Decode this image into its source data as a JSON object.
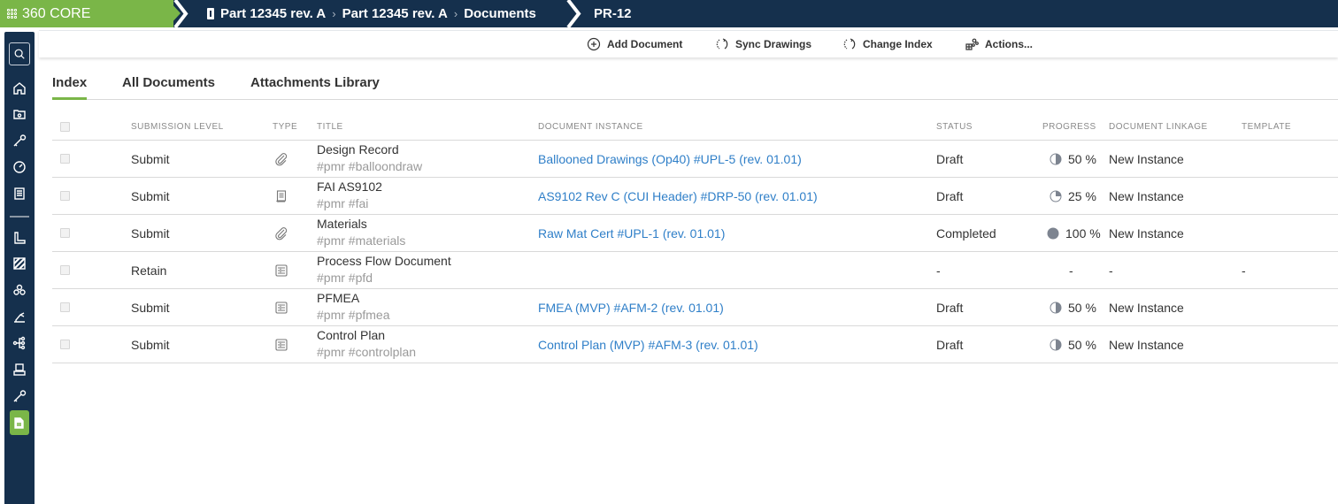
{
  "topbar": {
    "brand": "360 CORE",
    "breadcrumbs": [
      "Part 12345 rev. A",
      "Part 12345 rev. A",
      "Documents"
    ],
    "record": "PR-12"
  },
  "sidebar": {
    "items": [
      "search",
      "home",
      "folder",
      "gauge-tool",
      "dashboard",
      "document-list",
      "ruler",
      "hatch",
      "components",
      "robot-arm",
      "flow-tree",
      "machine",
      "gauge-tool-2",
      "documents-active"
    ]
  },
  "toolbar": {
    "add_document": "Add Document",
    "sync_drawings": "Sync Drawings",
    "change_index": "Change Index",
    "actions": "Actions..."
  },
  "tabs": [
    {
      "label": "Index",
      "active": true
    },
    {
      "label": "All Documents",
      "active": false
    },
    {
      "label": "Attachments Library",
      "active": false
    }
  ],
  "table": {
    "headers": {
      "submission_level": "SUBMISSION LEVEL",
      "type": "TYPE",
      "title": "TITLE",
      "document_instance": "DOCUMENT INSTANCE",
      "status": "STATUS",
      "progress": "PROGRESS",
      "document_linkage": "DOCUMENT LINKAGE",
      "template": "TEMPLATE"
    },
    "rows": [
      {
        "submission": "Submit",
        "type": "attachment",
        "title": "Design Record",
        "tags": "#pmr #balloondraw",
        "instance": "Ballooned Drawings (Op40) #UPL-5 (rev. 01.01)",
        "status": "Draft",
        "progress": 50,
        "progress_label": "50 %",
        "linkage": "New Instance",
        "template": ""
      },
      {
        "submission": "Submit",
        "type": "form",
        "title": "FAI AS9102",
        "tags": "#pmr #fai",
        "instance": "AS9102 Rev C (CUI Header) #DRP-50 (rev. 01.01)",
        "status": "Draft",
        "progress": 25,
        "progress_label": "25 %",
        "linkage": "New Instance",
        "template": ""
      },
      {
        "submission": "Submit",
        "type": "attachment",
        "title": "Materials",
        "tags": "#pmr #materials",
        "instance": "Raw Mat Cert #UPL-1 (rev. 01.01)",
        "status": "Completed",
        "progress": 100,
        "progress_label": "100 %",
        "linkage": "New Instance",
        "template": ""
      },
      {
        "submission": "Retain",
        "type": "list",
        "title": "Process Flow Document",
        "tags": "#pmr #pfd",
        "instance": "",
        "status": "-",
        "progress": null,
        "progress_label": "-",
        "linkage": "-",
        "template": "-"
      },
      {
        "submission": "Submit",
        "type": "list",
        "title": "PFMEA",
        "tags": "#pmr #pfmea",
        "instance": "FMEA (MVP) #AFM-2 (rev. 01.01)",
        "status": "Draft",
        "progress": 50,
        "progress_label": "50 %",
        "linkage": "New Instance",
        "template": ""
      },
      {
        "submission": "Submit",
        "type": "list",
        "title": "Control Plan",
        "tags": "#pmr #controlplan",
        "instance": "Control Plan (MVP) #AFM-3 (rev. 01.01)",
        "status": "Draft",
        "progress": 50,
        "progress_label": "50 %",
        "linkage": "New Instance",
        "template": ""
      }
    ]
  },
  "colors": {
    "navy": "#15304d",
    "green": "#7ab648",
    "link": "#2f7fc8",
    "progress": "#7d8490"
  }
}
